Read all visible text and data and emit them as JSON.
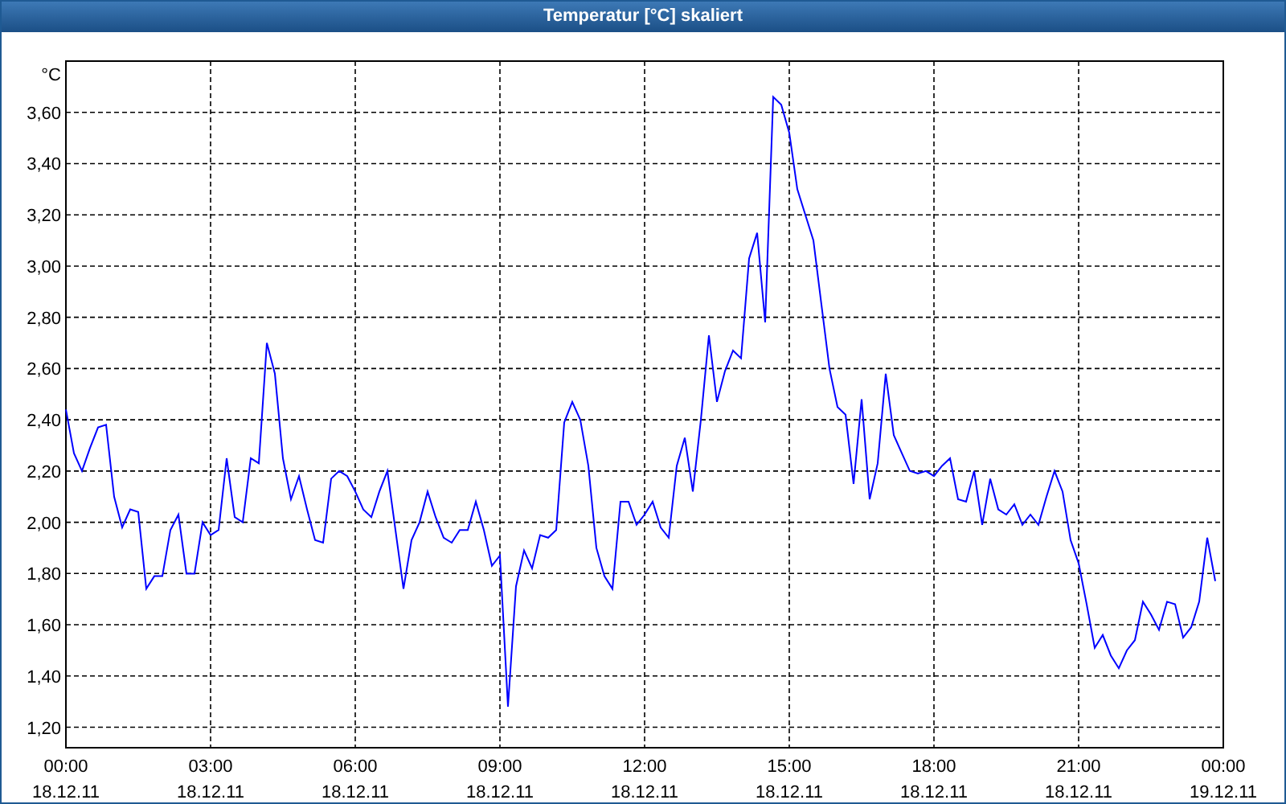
{
  "window": {
    "title": "Temperatur [°C] skaliert"
  },
  "chart_data": {
    "type": "line",
    "ylabel": "°C",
    "ylim": [
      1.12,
      3.8
    ],
    "grid": true,
    "yticks": [
      {
        "value": 1.2,
        "label": "1,20"
      },
      {
        "value": 1.4,
        "label": "1,40"
      },
      {
        "value": 1.6,
        "label": "1,60"
      },
      {
        "value": 1.8,
        "label": "1,80"
      },
      {
        "value": 2.0,
        "label": "2,00"
      },
      {
        "value": 2.2,
        "label": "2,20"
      },
      {
        "value": 2.4,
        "label": "2,40"
      },
      {
        "value": 2.6,
        "label": "2,60"
      },
      {
        "value": 2.8,
        "label": "2,80"
      },
      {
        "value": 3.0,
        "label": "3,00"
      },
      {
        "value": 3.2,
        "label": "3,20"
      },
      {
        "value": 3.4,
        "label": "3,40"
      },
      {
        "value": 3.6,
        "label": "3,60"
      }
    ],
    "categories": [
      "00:00 18.12.11",
      null,
      null,
      null,
      null,
      null,
      null,
      null,
      null,
      null,
      null,
      null,
      null,
      null,
      null,
      null,
      null,
      null,
      "03:00 18.12.11",
      null,
      null,
      null,
      null,
      null,
      null,
      null,
      null,
      null,
      null,
      null,
      null,
      null,
      null,
      null,
      null,
      null,
      "06:00 18.12.11",
      null,
      null,
      null,
      null,
      null,
      null,
      null,
      null,
      null,
      null,
      null,
      null,
      null,
      null,
      null,
      null,
      null,
      "09:00 18.12.11",
      null,
      null,
      null,
      null,
      null,
      null,
      null,
      null,
      null,
      null,
      null,
      null,
      null,
      null,
      null,
      null,
      null,
      "12:00 18.12.11",
      null,
      null,
      null,
      null,
      null,
      null,
      null,
      null,
      null,
      null,
      null,
      null,
      null,
      null,
      null,
      null,
      null,
      "15:00 18.12.11",
      null,
      null,
      null,
      null,
      null,
      null,
      null,
      null,
      null,
      null,
      null,
      null,
      null,
      null,
      null,
      null,
      null,
      "18:00 18.12.11",
      null,
      null,
      null,
      null,
      null,
      null,
      null,
      null,
      null,
      null,
      null,
      null,
      null,
      null,
      null,
      null,
      null,
      "21:00 18.12.11",
      null,
      null,
      null,
      null,
      null,
      null,
      null,
      null,
      null,
      null,
      null,
      null,
      null,
      null,
      null,
      null,
      null,
      "00:00 19.12.11"
    ],
    "series": [
      {
        "color": "#0000ff",
        "values": [
          2.44,
          2.27,
          2.2,
          2.29,
          2.37,
          2.38,
          2.1,
          1.98,
          2.05,
          2.04,
          1.74,
          1.79,
          1.79,
          1.97,
          2.03,
          1.8,
          1.8,
          2.0,
          1.95,
          1.97,
          2.25,
          2.02,
          2.0,
          2.25,
          2.23,
          2.7,
          2.58,
          2.25,
          2.09,
          2.18,
          2.05,
          1.93,
          1.92,
          2.17,
          2.2,
          2.18,
          2.12,
          2.05,
          2.02,
          2.12,
          2.2,
          1.97,
          1.74,
          1.93,
          2.0,
          2.12,
          2.02,
          1.94,
          1.92,
          1.97,
          1.97,
          2.08,
          1.97,
          1.83,
          1.87,
          1.28,
          1.75,
          1.89,
          1.82,
          1.95,
          1.94,
          1.97,
          2.39,
          2.47,
          2.4,
          2.22,
          1.9,
          1.79,
          1.74,
          2.08,
          2.08,
          1.99,
          2.03,
          2.08,
          1.98,
          1.94,
          2.22,
          2.33,
          2.12,
          2.4,
          2.73,
          2.47,
          2.59,
          2.67,
          2.64,
          3.03,
          3.13,
          2.78,
          3.66,
          3.63,
          3.52,
          3.3,
          3.2,
          3.1,
          2.85,
          2.6,
          2.45,
          2.42,
          2.15,
          2.48,
          2.09,
          2.23,
          2.58,
          2.34,
          2.27,
          2.2,
          2.19,
          2.2,
          2.18,
          2.22,
          2.25,
          2.09,
          2.08,
          2.2,
          1.99,
          2.17,
          2.05,
          2.03,
          2.07,
          1.99,
          2.03,
          1.99,
          2.1,
          2.2,
          2.12,
          1.93,
          1.84,
          1.68,
          1.51,
          1.56,
          1.48,
          1.43,
          1.5,
          1.54,
          1.69,
          1.64,
          1.58,
          1.69,
          1.68,
          1.55,
          1.59,
          1.69,
          1.94,
          1.77,
          null
        ]
      }
    ]
  }
}
